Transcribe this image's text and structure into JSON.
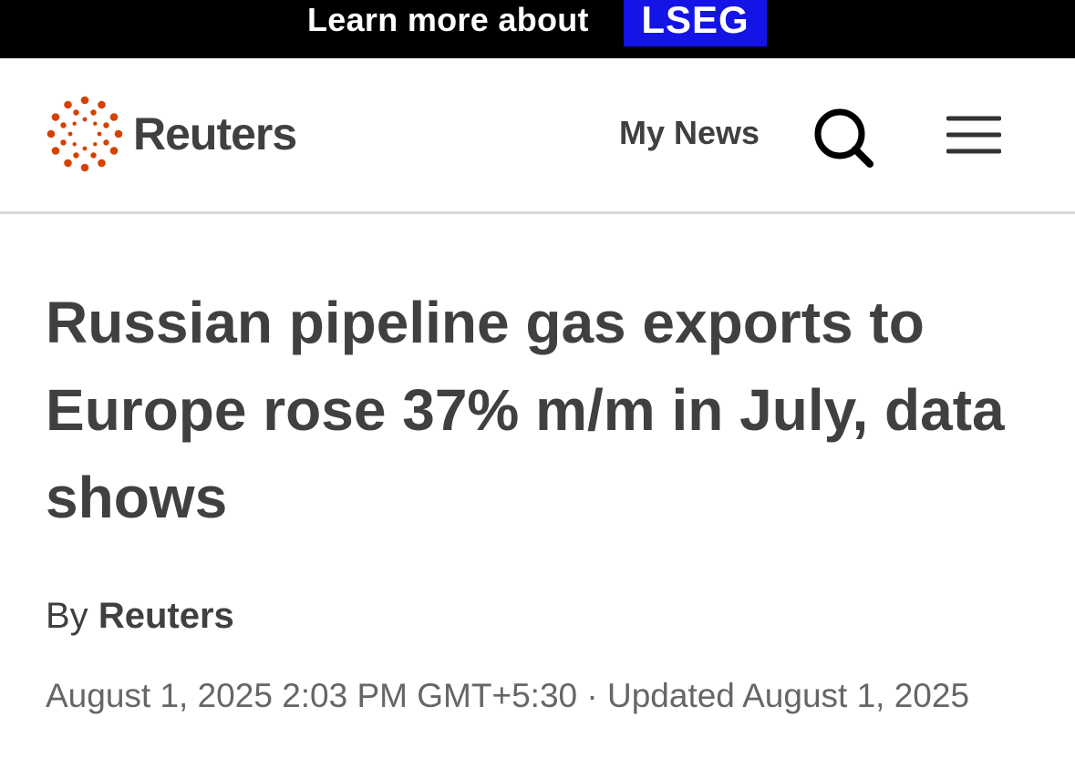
{
  "promo": {
    "text": "Learn more about",
    "brand": "LSEG",
    "brand_color": "#1414e6"
  },
  "header": {
    "logo_text": "Reuters",
    "logo_color": "#d64000",
    "my_news_label": "My News",
    "search_icon": "search-icon",
    "menu_icon": "hamburger-menu-icon"
  },
  "article": {
    "headline": "Russian pipeline gas exports to Europe rose 37% m/m in July, data shows",
    "byline_prefix": "By",
    "byline_author": "Reuters",
    "published": "August 1, 2025 2:03 PM GMT+5:30",
    "separator": "·",
    "updated": "Updated August 1, 2025"
  }
}
